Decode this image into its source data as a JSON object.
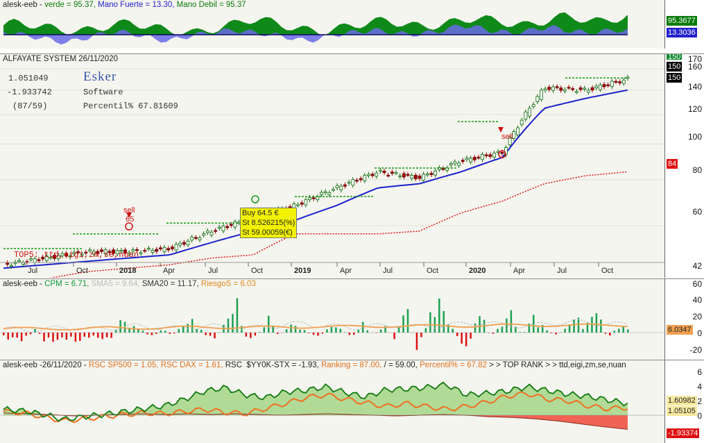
{
  "top": {
    "title_prefix": "alesk-eeb - ",
    "l1": "verde = 95.37,",
    "l2": "Mano Fuerte = 13.30,",
    "l3": "Mano Debil = 95.37",
    "tag1": "95.3677",
    "tag2": "13.3036",
    "colors": {
      "verde": "#0a7a0a",
      "fuerte": "#2222cc",
      "debil": "#0a7a0a"
    }
  },
  "main": {
    "title": "ALFAYATE SYSTEM 26/11/2020",
    "info1": "1.051049",
    "info2": "-1.933742",
    "info3": "(87/59)",
    "logo": "Esker",
    "software": "Software",
    "percentil": "Percentil% 67.81609",
    "sell1_word": "sell",
    "sell1_num": "65",
    "sell2_word": "sell",
    "buy_line1": "Buy 64.5 €",
    "buy_line2": "St 8.526215(%)",
    "buy_line3": "St 59.00059(€)",
    "top5": "TOP5: ttd,eigi,zm,se,nuan",
    "ticks": [
      "170",
      "160",
      "140",
      "120",
      "100",
      "80",
      "60",
      "42"
    ],
    "tags": [
      "150",
      "150",
      "150",
      "84"
    ],
    "xlabels": [
      {
        "t": "Jul",
        "b": false
      },
      {
        "t": "Oct",
        "b": false
      },
      {
        "t": "2018",
        "b": true
      },
      {
        "t": "Apr",
        "b": false
      },
      {
        "t": "Jul",
        "b": false
      },
      {
        "t": "Oct",
        "b": false
      },
      {
        "t": "2019",
        "b": true
      },
      {
        "t": "Apr",
        "b": false
      },
      {
        "t": "Jul",
        "b": false
      },
      {
        "t": "Oct",
        "b": false
      },
      {
        "t": "2020",
        "b": true
      },
      {
        "t": "Apr",
        "b": false
      },
      {
        "t": "Jul",
        "b": false
      },
      {
        "t": "Oct",
        "b": false
      }
    ]
  },
  "cpm": {
    "prefix": "alesk-eeb - ",
    "cpm": "CPM = 6.71,",
    "sma5": "SMA5 = 9.64,",
    "sma20": "SMA20 = 11.17,",
    "riesgo": "RiesgoS = 6.03",
    "ticks": [
      "60",
      "40",
      "20",
      "0",
      "-20"
    ],
    "tag": "6.0347"
  },
  "rsc": {
    "prefix": "alesk-eeb -26/11/2020 - ",
    "sp": "RSC SP500 = 1.05,",
    "dax": "RSC DAX = 1.61,",
    "rsc": "RSC  $YY0K-STX = -1.93,",
    "rank": "Ranking = 87.00,",
    "slash": "/ = 59.00,",
    "pct": "Percentil% = 67.82",
    "top": "> > TOP RANK > > ttd,eigi,zm,se,nuan",
    "ticks": [
      "6",
      "4",
      "2",
      "0"
    ],
    "tags": [
      "1.60982",
      "1.05105",
      "-1.93374"
    ]
  },
  "chart_data": [
    {
      "type": "area",
      "title": "alesk-eeb - verde = 95.37, Mano Fuerte = 13.30, Mano Debil = 95.37",
      "series": [
        {
          "name": "verde",
          "values": [
            80,
            85,
            82,
            78,
            75,
            72,
            70,
            74,
            78,
            82,
            85,
            80,
            76,
            72,
            70,
            68,
            72,
            76,
            82,
            88,
            90,
            86,
            80,
            75,
            72,
            70,
            74,
            78,
            82,
            86,
            88,
            84,
            80,
            78,
            80,
            84,
            88,
            92,
            90,
            86,
            82,
            80,
            84,
            90,
            95,
            92,
            88,
            86,
            90,
            95
          ]
        },
        {
          "name": "Mano Fuerte",
          "values": [
            10,
            5,
            -5,
            -10,
            -20,
            -25,
            -15,
            -5,
            5,
            10,
            5,
            -5,
            -15,
            -20,
            -10,
            0,
            5,
            10,
            15,
            10,
            5,
            0,
            -5,
            -15,
            -20,
            -10,
            0,
            5,
            10,
            15,
            10,
            5,
            0,
            5,
            10,
            20,
            30,
            25,
            15,
            10,
            5,
            10,
            20,
            25,
            15,
            10,
            5,
            10,
            15,
            13
          ]
        }
      ]
    },
    {
      "type": "line",
      "title": "ALFAYATE SYSTEM 26/11/2020",
      "ylim": [
        42,
        170
      ],
      "x": [
        "2017-05",
        "2017-07",
        "2017-10",
        "2018-01",
        "2018-04",
        "2018-07",
        "2018-10",
        "2019-01",
        "2019-04",
        "2019-07",
        "2019-10",
        "2020-01",
        "2020-04",
        "2020-07",
        "2020-10",
        "2020-11"
      ],
      "series": [
        {
          "name": "Price",
          "values": [
            47,
            49,
            51,
            51,
            52,
            58,
            63,
            68,
            76,
            84,
            81,
            90,
            95,
            142,
            140,
            150
          ]
        },
        {
          "name": "Trend",
          "values": [
            46,
            47,
            48,
            49,
            50,
            54,
            58,
            62,
            68,
            76,
            78,
            84,
            92,
            125,
            133,
            140
          ]
        },
        {
          "name": "Stop",
          "values": [
            42,
            43,
            45,
            46,
            47,
            49,
            50,
            57,
            57,
            57,
            58,
            65,
            70,
            78,
            82,
            84
          ]
        }
      ]
    },
    {
      "type": "bar",
      "title": "alesk-eeb - CPM = 6.71, SMA5 = 9.64, SMA20 = 11.17, RiesgoS = 6.03",
      "ylim": [
        -25,
        62
      ],
      "series": [
        {
          "name": "CPM",
          "values": [
            -8,
            -6,
            -10,
            5,
            -12,
            -9,
            -7,
            -11,
            -5,
            -6,
            -10,
            15,
            8,
            4,
            -6,
            5,
            -4,
            10,
            15,
            -3,
            -6,
            12,
            38,
            -8,
            -4,
            20,
            -5,
            10,
            6,
            -2,
            -4,
            9,
            3,
            -5,
            12,
            -3,
            8,
            -8,
            35,
            -20,
            10,
            42,
            15,
            -10,
            -18,
            30,
            -6,
            8,
            25,
            -5,
            20,
            7,
            -3,
            3,
            20,
            6,
            30,
            -7,
            6,
            6.71
          ]
        },
        {
          "name": "SMA5",
          "values": [
            5,
            4,
            3,
            4,
            5,
            6,
            5,
            4,
            5,
            6,
            8,
            7,
            6,
            5,
            6,
            7,
            8,
            6,
            5,
            6,
            7,
            8,
            10,
            11,
            9,
            8,
            7,
            6,
            7,
            8,
            9,
            8,
            7,
            8,
            9,
            10,
            11,
            12,
            10,
            9,
            8,
            9,
            11,
            12,
            13,
            12,
            11,
            10,
            9.64
          ]
        },
        {
          "name": "SMA20",
          "values": [
            6,
            6,
            6,
            6,
            7,
            7,
            7,
            8,
            8,
            8,
            8,
            8,
            9,
            9,
            9,
            10,
            10,
            10,
            10,
            11,
            11,
            11,
            11,
            11,
            11.17
          ]
        }
      ]
    },
    {
      "type": "line",
      "title": "alesk-eeb -26/11/2020 - RSC SP500 = 1.05, RSC DAX = 1.61, RSC $YY0K-STX = -1.93, Ranking = 87.00, / = 59.00, Percentil% = 67.82",
      "ylim": [
        -2,
        7
      ],
      "series": [
        {
          "name": "RSC SP500",
          "values": [
            0.5,
            0.3,
            -0.2,
            -0.8,
            -0.5,
            -0.2,
            0.1,
            0.3,
            0.2,
            0.5,
            0.8,
            0.4,
            0.2,
            0.9,
            1.6,
            2.4,
            2.8,
            2.2,
            1.7,
            1.2,
            1.6,
            1.2,
            0.8,
            1.2,
            1.8,
            2.6,
            3.0,
            2.2,
            2.0,
            1.3,
            0.9,
            1.05
          ]
        },
        {
          "name": "RSC DAX",
          "values": [
            0.8,
            0.6,
            0.1,
            -0.6,
            -0.2,
            0.1,
            0.5,
            0.9,
            1.3,
            2.2,
            3.3,
            3.8,
            2.8,
            2.4,
            3.2,
            3.4,
            3.9,
            3.1,
            2.5,
            3.5,
            3.6,
            3.8,
            4.2,
            2.8,
            3.0,
            3.3,
            3.9,
            3.4,
            2.9,
            2.6,
            2.1,
            1.61
          ]
        },
        {
          "name": "RSC $YY0K-STX",
          "values": [
            0.3,
            0.2,
            0.1,
            -0.1,
            0.0,
            0.1,
            0.2,
            0.1,
            0.2,
            0.1,
            0.2,
            0.1,
            0.0,
            0.1,
            0.2,
            0.1,
            0.0,
            -0.1,
            0.0,
            0.1,
            0.0,
            -0.2,
            -0.3,
            -0.5,
            -0.8,
            -1.2,
            -1.6,
            -1.93
          ]
        }
      ]
    }
  ]
}
